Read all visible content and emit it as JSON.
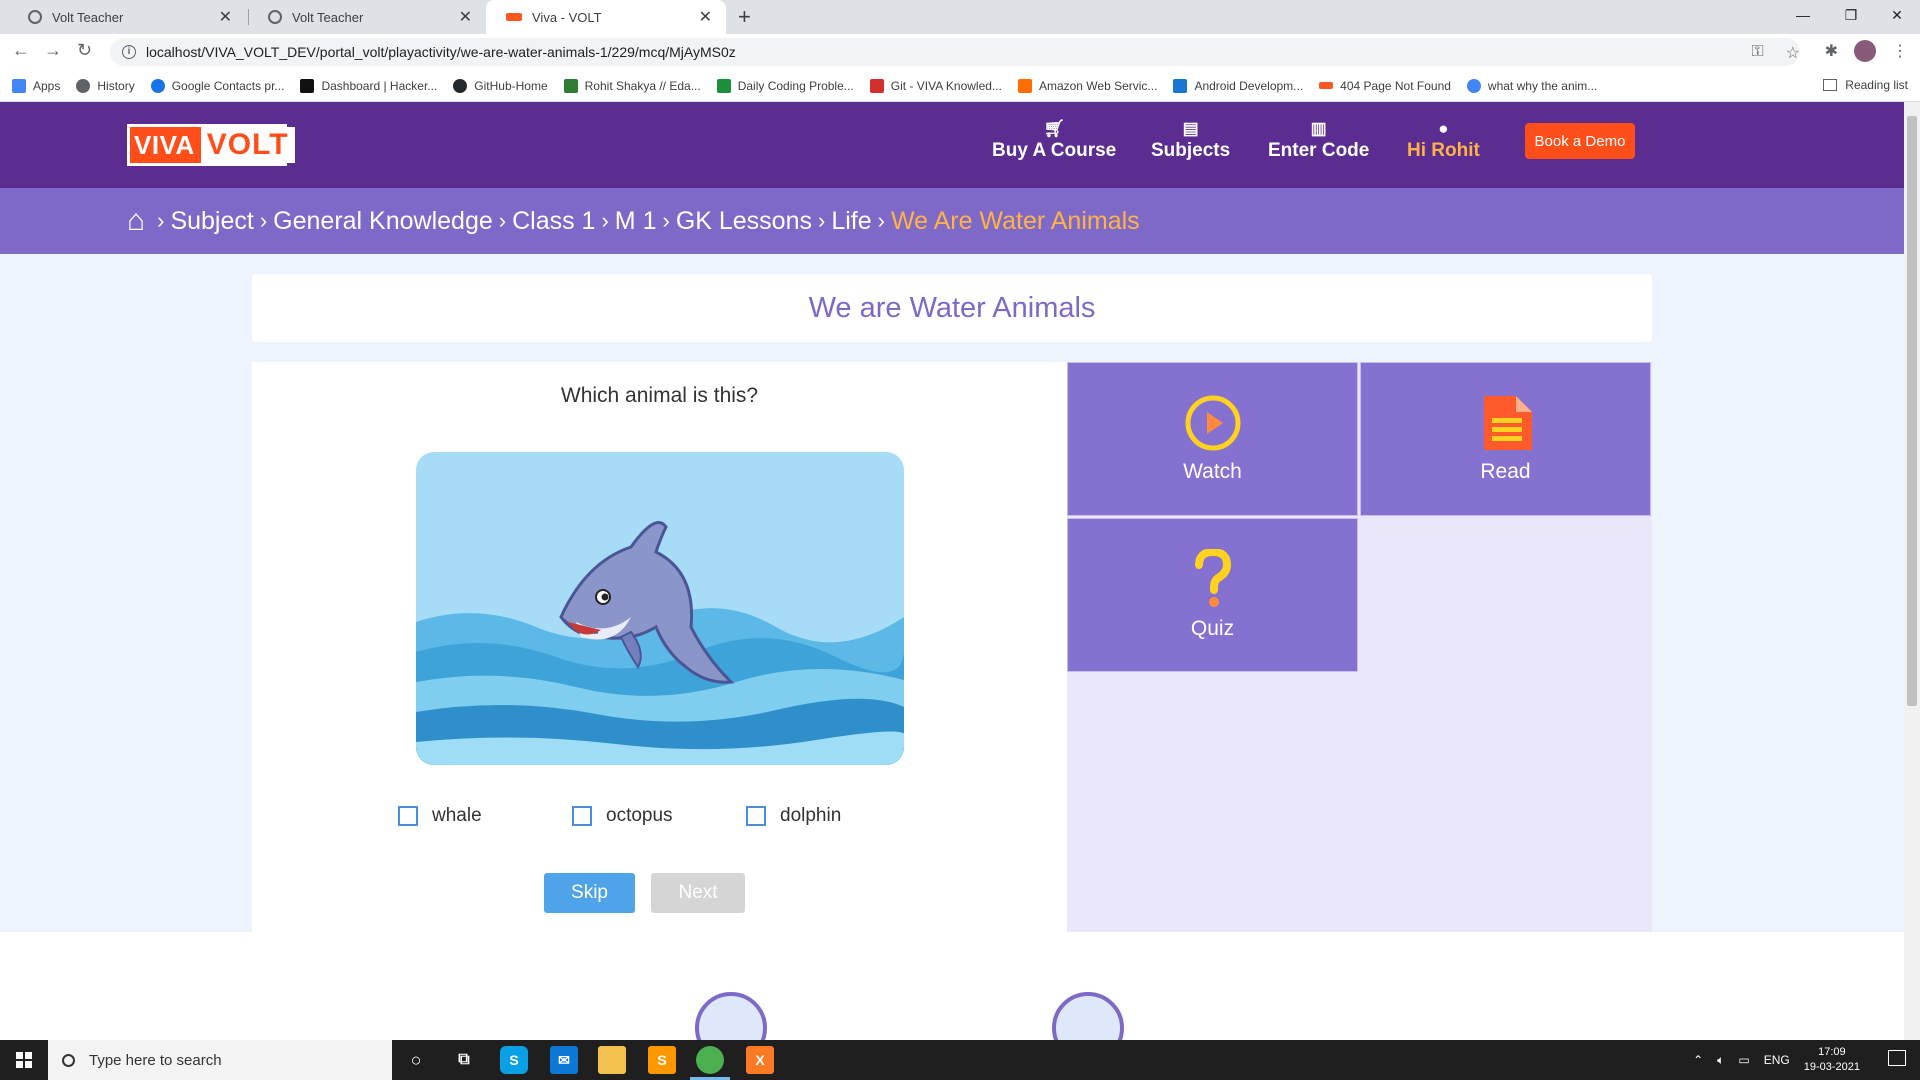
{
  "browser": {
    "tabs": [
      {
        "title": "Volt Teacher"
      },
      {
        "title": "Volt Teacher"
      },
      {
        "title": "Viva - VOLT"
      }
    ],
    "url": "localhost/VIVA_VOLT_DEV/portal_volt/playactivity/we-are-water-animals-1/229/mcq/MjAyMS0z",
    "bookmarks": [
      {
        "label": "Apps",
        "color": "#4285f4"
      },
      {
        "label": "History",
        "color": "#5f6368"
      },
      {
        "label": "Google Contacts pr...",
        "color": "#1a73e8"
      },
      {
        "label": "Dashboard | Hacker...",
        "color": "#111111"
      },
      {
        "label": "GitHub-Home",
        "color": "#24292e"
      },
      {
        "label": "Rohit Shakya // Eda...",
        "color": "#2e7d32"
      },
      {
        "label": "Daily Coding Proble...",
        "color": "#1b8f3a"
      },
      {
        "label": "Git - VIVA Knowled...",
        "color": "#d32f2f"
      },
      {
        "label": "Amazon Web Servic...",
        "color": "#ff6d00"
      },
      {
        "label": "Android Developm...",
        "color": "#1976d2"
      },
      {
        "label": "404 Page Not Found",
        "color": "#ff5722"
      },
      {
        "label": "what why the anim...",
        "color": "#4285f4"
      }
    ],
    "reading_list": "Reading list"
  },
  "header": {
    "logo_left": "VIVA",
    "logo_right": "VOLT",
    "nav": [
      {
        "label": "Buy A Course",
        "icon": "cart-icon"
      },
      {
        "label": "Subjects",
        "icon": "book-icon"
      },
      {
        "label": "Enter Code",
        "icon": "barcode-icon"
      },
      {
        "label": "Hi Rohit",
        "icon": "user-icon"
      }
    ],
    "demo_button": "Book a Demo"
  },
  "breadcrumb": [
    "Subject",
    "General Knowledge",
    "Class 1",
    "M 1",
    "GK Lessons",
    "Life",
    "We Are Water Animals"
  ],
  "activity": {
    "title": "We are Water Animals",
    "question": "Which animal is this?",
    "options": [
      "whale",
      "octopus",
      "dolphin"
    ],
    "skip_label": "Skip",
    "next_label": "Next"
  },
  "tiles": [
    {
      "label": "Watch",
      "icon": "play-icon"
    },
    {
      "label": "Read",
      "icon": "document-icon"
    },
    {
      "label": "Quiz",
      "icon": "question-icon"
    }
  ],
  "taskbar": {
    "search_placeholder": "Type here to search",
    "language": "ENG",
    "time": "17:09",
    "date": "19-03-2021"
  }
}
